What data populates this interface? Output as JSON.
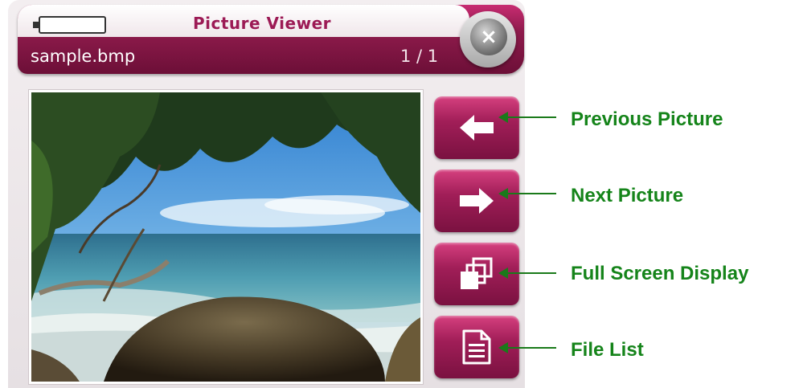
{
  "app": {
    "title": "Picture Viewer",
    "filename": "sample.bmp",
    "counter": "1 / 1",
    "accent": "#9c1a55"
  },
  "controls": {
    "close": {
      "icon": "close-icon",
      "glyph": "×"
    },
    "buttons": [
      {
        "id": "previous",
        "icon": "arrow-left-icon"
      },
      {
        "id": "next",
        "icon": "arrow-right-icon"
      },
      {
        "id": "fullscreen",
        "icon": "fullscreen-windows-icon"
      },
      {
        "id": "filelist",
        "icon": "document-icon"
      }
    ]
  },
  "annotations": {
    "previous": "Previous Picture",
    "next": "Next Picture",
    "fullscreen": "Full Screen Display",
    "filelist": "File List",
    "color": "#15841a"
  }
}
